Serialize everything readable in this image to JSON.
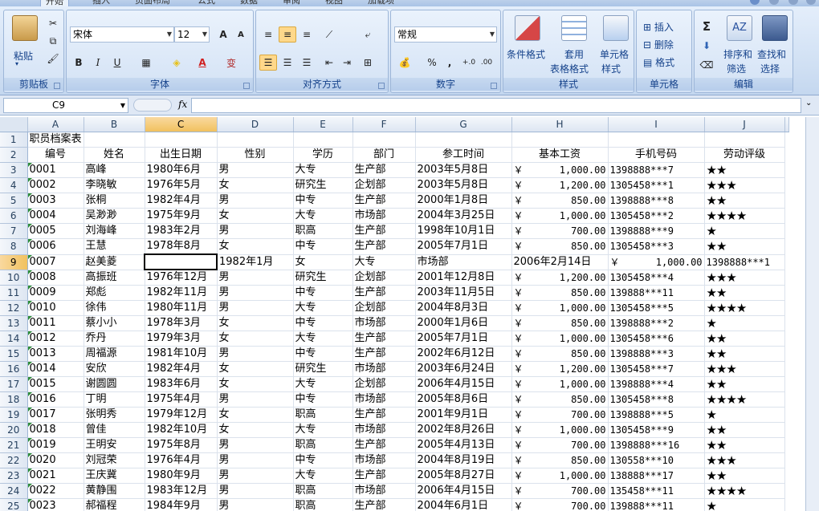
{
  "tabs": [
    "开始",
    "插入",
    "页面布局",
    "公式",
    "数据",
    "审阅",
    "视图",
    "加载项"
  ],
  "ribbon": {
    "clipboard": {
      "label": "剪贴板",
      "paste": "粘贴"
    },
    "font": {
      "label": "字体",
      "name": "宋体",
      "size": "12",
      "bold": "B",
      "italic": "I",
      "underline": "U",
      "grow": "A",
      "shrink": "A",
      "fontcolor": "A",
      "wen": "变"
    },
    "align": {
      "label": "对齐方式"
    },
    "number": {
      "label": "数字",
      "format": "常规",
      "percent": "%",
      "comma": ","
    },
    "styles": {
      "label": "样式",
      "cond1": "条件格式",
      "table1": "套用",
      "table2": "表格格式",
      "cell1": "单元格",
      "cell2": "样式"
    },
    "cells": {
      "label": "单元格",
      "insert": "插入",
      "delete": "删除",
      "format": "格式"
    },
    "editing": {
      "label": "编辑",
      "sigma": "Σ",
      "sort1": "排序和",
      "sort2": "筛选",
      "find1": "查找和",
      "find2": "选择"
    }
  },
  "formula_bar": {
    "name_box": "C9",
    "fx": "fx",
    "formula": ""
  },
  "columns": [
    "A",
    "B",
    "C",
    "D",
    "E",
    "F",
    "G",
    "H",
    "I",
    "J"
  ],
  "title_row": "职员档案表",
  "headers": [
    "编号",
    "姓名",
    "出生日期",
    "性别",
    "学历",
    "部门",
    "参工时间",
    "基本工资",
    "手机号码",
    "劳动评级"
  ],
  "rows": [
    [
      "0001",
      "高峰",
      "1980年6月",
      "男",
      "大专",
      "生产部",
      "2003年5月8日",
      "￥",
      "1,000.00",
      "1398888***7",
      "★★"
    ],
    [
      "0002",
      "李晓敏",
      "1976年5月",
      "女",
      "研究生",
      "企划部",
      "2003年5月8日",
      "￥",
      "1,200.00",
      "1305458***1",
      "★★★"
    ],
    [
      "0003",
      "张桐",
      "1982年4月",
      "男",
      "中专",
      "生产部",
      "2000年1月8日",
      "￥",
      "850.00",
      "1398888***8",
      "★★"
    ],
    [
      "0004",
      "吴渺渺",
      "1975年9月",
      "女",
      "大专",
      "市场部",
      "2004年3月25日",
      "￥",
      "1,000.00",
      "1305458***2",
      "★★★★"
    ],
    [
      "0005",
      "刘海峰",
      "1983年2月",
      "男",
      "职高",
      "生产部",
      "1998年10月1日",
      "￥",
      "700.00",
      "1398888***9",
      "★"
    ],
    [
      "0006",
      "王慧",
      "1978年8月",
      "女",
      "中专",
      "生产部",
      "2005年7月1日",
      "￥",
      "850.00",
      "1305458***3",
      "★★"
    ],
    [
      "0008",
      "高振班",
      "1976年12月",
      "男",
      "研究生",
      "企划部",
      "2001年12月8日",
      "￥",
      "1,200.00",
      "1305458***4",
      "★★★"
    ],
    [
      "0009",
      "郑彪",
      "1982年11月",
      "男",
      "中专",
      "生产部",
      "2003年11月5日",
      "￥",
      "850.00",
      "139888***11",
      "★★"
    ],
    [
      "0010",
      "徐伟",
      "1980年11月",
      "男",
      "大专",
      "企划部",
      "2004年8月3日",
      "￥",
      "1,000.00",
      "1305458***5",
      "★★★★"
    ],
    [
      "0011",
      "蔡小小",
      "1978年3月",
      "女",
      "中专",
      "市场部",
      "2000年1月6日",
      "￥",
      "850.00",
      "1398888***2",
      "★"
    ],
    [
      "0012",
      "乔丹",
      "1979年3月",
      "女",
      "大专",
      "生产部",
      "2005年7月1日",
      "￥",
      "1,000.00",
      "1305458***6",
      "★★"
    ],
    [
      "0013",
      "周福源",
      "1981年10月",
      "男",
      "中专",
      "生产部",
      "2002年6月12日",
      "￥",
      "850.00",
      "1398888***3",
      "★★"
    ],
    [
      "0014",
      "安欣",
      "1982年4月",
      "女",
      "研究生",
      "市场部",
      "2003年6月24日",
      "￥",
      "1,200.00",
      "1305458***7",
      "★★★"
    ],
    [
      "0015",
      "谢圆圆",
      "1983年6月",
      "女",
      "大专",
      "企划部",
      "2006年4月15日",
      "￥",
      "1,000.00",
      "1398888***4",
      "★★"
    ],
    [
      "0016",
      "丁明",
      "1975年4月",
      "男",
      "中专",
      "市场部",
      "2005年8月6日",
      "￥",
      "850.00",
      "1305458***8",
      "★★★★"
    ],
    [
      "0017",
      "张明秀",
      "1979年12月",
      "女",
      "职高",
      "生产部",
      "2001年9月1日",
      "￥",
      "700.00",
      "1398888***5",
      "★"
    ],
    [
      "0018",
      "曾佳",
      "1982年10月",
      "女",
      "大专",
      "市场部",
      "2002年8月26日",
      "￥",
      "1,000.00",
      "1305458***9",
      "★★"
    ],
    [
      "0019",
      "王明安",
      "1975年8月",
      "男",
      "职高",
      "生产部",
      "2005年4月13日",
      "￥",
      "700.00",
      "1398888***16",
      "★★"
    ],
    [
      "0020",
      "刘冠荣",
      "1976年4月",
      "男",
      "中专",
      "市场部",
      "2004年8月19日",
      "￥",
      "850.00",
      "130558***10",
      "★★★"
    ],
    [
      "0021",
      "王庆冀",
      "1980年9月",
      "男",
      "大专",
      "生产部",
      "2005年8月27日",
      "￥",
      "1,000.00",
      "138888***17",
      "★★"
    ],
    [
      "0022",
      "黄静围",
      "1983年12月",
      "男",
      "职高",
      "市场部",
      "2006年4月15日",
      "￥",
      "700.00",
      "135458***11",
      "★★★★"
    ],
    [
      "0023",
      "郝福程",
      "1984年9月",
      "男",
      "职高",
      "生产部",
      "2004年6月1日",
      "￥",
      "700.00",
      "139888***11",
      "★"
    ]
  ],
  "row9": [
    "0007",
    "赵美菱",
    "",
    "1982年1月",
    "女",
    "大专",
    "市场部",
    "2006年2月14日",
    "￥",
    "1,000.00",
    "1398888***1",
    "★★"
  ]
}
